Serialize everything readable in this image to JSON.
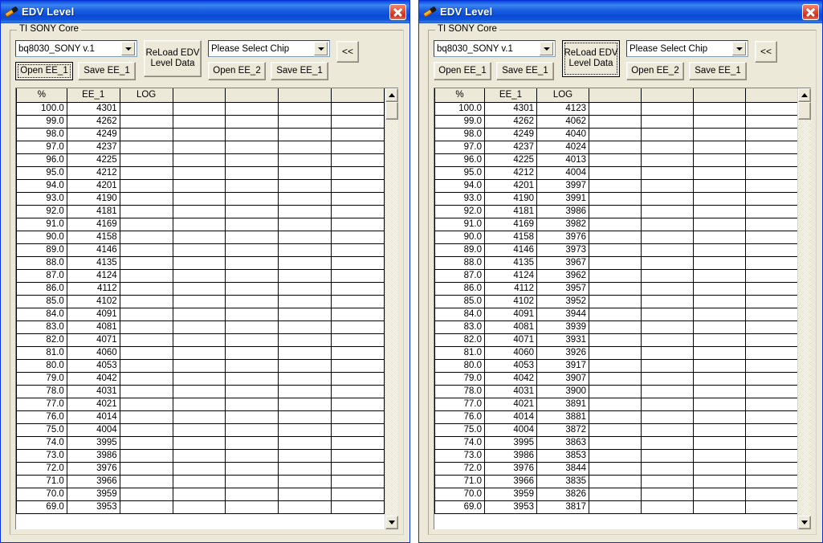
{
  "windows": [
    {
      "id": "left",
      "title": "EDV Level",
      "icon": "pen-icon",
      "close_label": "✕",
      "group_title": "TI SONY Core",
      "core_combo": {
        "value": "bq8030_SONY    v.1",
        "arrow": "chevron-down-icon"
      },
      "chip_combo": {
        "value": "Please Select Chip",
        "arrow": "chevron-down-icon"
      },
      "buttons": {
        "open_ee_1": "Open EE_1",
        "save_ee_1": "Save EE_1",
        "reload": "ReLoad EDV\nLevel Data",
        "reload_line1": "ReLoad EDV",
        "reload_line2": "Level Data",
        "open_ee_2": "Open EE_2",
        "save_ee_1_right": "Save EE_1",
        "collapse": "<<"
      },
      "focused_button": "open_ee_1",
      "grid": {
        "columns": [
          "%",
          "EE_1",
          "LOG",
          "",
          "",
          "",
          ""
        ],
        "rows": [
          [
            "100.0",
            "4301",
            "",
            "",
            "",
            "",
            ""
          ],
          [
            "99.0",
            "4262",
            "",
            "",
            "",
            "",
            ""
          ],
          [
            "98.0",
            "4249",
            "",
            "",
            "",
            "",
            ""
          ],
          [
            "97.0",
            "4237",
            "",
            "",
            "",
            "",
            ""
          ],
          [
            "96.0",
            "4225",
            "",
            "",
            "",
            "",
            ""
          ],
          [
            "95.0",
            "4212",
            "",
            "",
            "",
            "",
            ""
          ],
          [
            "94.0",
            "4201",
            "",
            "",
            "",
            "",
            ""
          ],
          [
            "93.0",
            "4190",
            "",
            "",
            "",
            "",
            ""
          ],
          [
            "92.0",
            "4181",
            "",
            "",
            "",
            "",
            ""
          ],
          [
            "91.0",
            "4169",
            "",
            "",
            "",
            "",
            ""
          ],
          [
            "90.0",
            "4158",
            "",
            "",
            "",
            "",
            ""
          ],
          [
            "89.0",
            "4146",
            "",
            "",
            "",
            "",
            ""
          ],
          [
            "88.0",
            "4135",
            "",
            "",
            "",
            "",
            ""
          ],
          [
            "87.0",
            "4124",
            "",
            "",
            "",
            "",
            ""
          ],
          [
            "86.0",
            "4112",
            "",
            "",
            "",
            "",
            ""
          ],
          [
            "85.0",
            "4102",
            "",
            "",
            "",
            "",
            ""
          ],
          [
            "84.0",
            "4091",
            "",
            "",
            "",
            "",
            ""
          ],
          [
            "83.0",
            "4081",
            "",
            "",
            "",
            "",
            ""
          ],
          [
            "82.0",
            "4071",
            "",
            "",
            "",
            "",
            ""
          ],
          [
            "81.0",
            "4060",
            "",
            "",
            "",
            "",
            ""
          ],
          [
            "80.0",
            "4053",
            "",
            "",
            "",
            "",
            ""
          ],
          [
            "79.0",
            "4042",
            "",
            "",
            "",
            "",
            ""
          ],
          [
            "78.0",
            "4031",
            "",
            "",
            "",
            "",
            ""
          ],
          [
            "77.0",
            "4021",
            "",
            "",
            "",
            "",
            ""
          ],
          [
            "76.0",
            "4014",
            "",
            "",
            "",
            "",
            ""
          ],
          [
            "75.0",
            "4004",
            "",
            "",
            "",
            "",
            ""
          ],
          [
            "74.0",
            "3995",
            "",
            "",
            "",
            "",
            ""
          ],
          [
            "73.0",
            "3986",
            "",
            "",
            "",
            "",
            ""
          ],
          [
            "72.0",
            "3976",
            "",
            "",
            "",
            "",
            ""
          ],
          [
            "71.0",
            "3966",
            "",
            "",
            "",
            "",
            ""
          ],
          [
            "70.0",
            "3959",
            "",
            "",
            "",
            "",
            ""
          ],
          [
            "69.0",
            "3953",
            "",
            "",
            "",
            "",
            ""
          ]
        ]
      }
    },
    {
      "id": "right",
      "title": "EDV Level",
      "icon": "pen-icon",
      "close_label": "✕",
      "group_title": "TI SONY Core",
      "core_combo": {
        "value": "bq8030_SONY    v.1",
        "arrow": "chevron-down-icon"
      },
      "chip_combo": {
        "value": "Please Select Chip",
        "arrow": "chevron-down-icon"
      },
      "buttons": {
        "open_ee_1": "Open EE_1",
        "save_ee_1": "Save EE_1",
        "reload": "ReLoad EDV\nLevel Data",
        "reload_line1": "ReLoad EDV",
        "reload_line2": "Level Data",
        "open_ee_2": "Open EE_2",
        "save_ee_1_right": "Save EE_1",
        "collapse": "<<"
      },
      "focused_button": "reload",
      "grid": {
        "columns": [
          "%",
          "EE_1",
          "LOG",
          "",
          "",
          "",
          ""
        ],
        "rows": [
          [
            "100.0",
            "4301",
            "4123",
            "",
            "",
            "",
            ""
          ],
          [
            "99.0",
            "4262",
            "4062",
            "",
            "",
            "",
            ""
          ],
          [
            "98.0",
            "4249",
            "4040",
            "",
            "",
            "",
            ""
          ],
          [
            "97.0",
            "4237",
            "4024",
            "",
            "",
            "",
            ""
          ],
          [
            "96.0",
            "4225",
            "4013",
            "",
            "",
            "",
            ""
          ],
          [
            "95.0",
            "4212",
            "4004",
            "",
            "",
            "",
            ""
          ],
          [
            "94.0",
            "4201",
            "3997",
            "",
            "",
            "",
            ""
          ],
          [
            "93.0",
            "4190",
            "3991",
            "",
            "",
            "",
            ""
          ],
          [
            "92.0",
            "4181",
            "3986",
            "",
            "",
            "",
            ""
          ],
          [
            "91.0",
            "4169",
            "3982",
            "",
            "",
            "",
            ""
          ],
          [
            "90.0",
            "4158",
            "3976",
            "",
            "",
            "",
            ""
          ],
          [
            "89.0",
            "4146",
            "3973",
            "",
            "",
            "",
            ""
          ],
          [
            "88.0",
            "4135",
            "3967",
            "",
            "",
            "",
            ""
          ],
          [
            "87.0",
            "4124",
            "3962",
            "",
            "",
            "",
            ""
          ],
          [
            "86.0",
            "4112",
            "3957",
            "",
            "",
            "",
            ""
          ],
          [
            "85.0",
            "4102",
            "3952",
            "",
            "",
            "",
            ""
          ],
          [
            "84.0",
            "4091",
            "3944",
            "",
            "",
            "",
            ""
          ],
          [
            "83.0",
            "4081",
            "3939",
            "",
            "",
            "",
            ""
          ],
          [
            "82.0",
            "4071",
            "3931",
            "",
            "",
            "",
            ""
          ],
          [
            "81.0",
            "4060",
            "3926",
            "",
            "",
            "",
            ""
          ],
          [
            "80.0",
            "4053",
            "3917",
            "",
            "",
            "",
            ""
          ],
          [
            "79.0",
            "4042",
            "3907",
            "",
            "",
            "",
            ""
          ],
          [
            "78.0",
            "4031",
            "3900",
            "",
            "",
            "",
            ""
          ],
          [
            "77.0",
            "4021",
            "3891",
            "",
            "",
            "",
            ""
          ],
          [
            "76.0",
            "4014",
            "3881",
            "",
            "",
            "",
            ""
          ],
          [
            "75.0",
            "4004",
            "3872",
            "",
            "",
            "",
            ""
          ],
          [
            "74.0",
            "3995",
            "3863",
            "",
            "",
            "",
            ""
          ],
          [
            "73.0",
            "3986",
            "3853",
            "",
            "",
            "",
            ""
          ],
          [
            "72.0",
            "3976",
            "3844",
            "",
            "",
            "",
            ""
          ],
          [
            "71.0",
            "3966",
            "3835",
            "",
            "",
            "",
            ""
          ],
          [
            "70.0",
            "3959",
            "3826",
            "",
            "",
            "",
            ""
          ],
          [
            "69.0",
            "3953",
            "3817",
            "",
            "",
            "",
            ""
          ]
        ]
      }
    }
  ],
  "colors": {
    "titlebar_blue": "#0a4ad8",
    "window_border": "#0831d9",
    "face": "#ece9d8",
    "close_red": "#c6301a"
  },
  "scrollbar": {
    "up_arrow": "triangle-up-icon",
    "down_arrow": "triangle-down-icon"
  }
}
